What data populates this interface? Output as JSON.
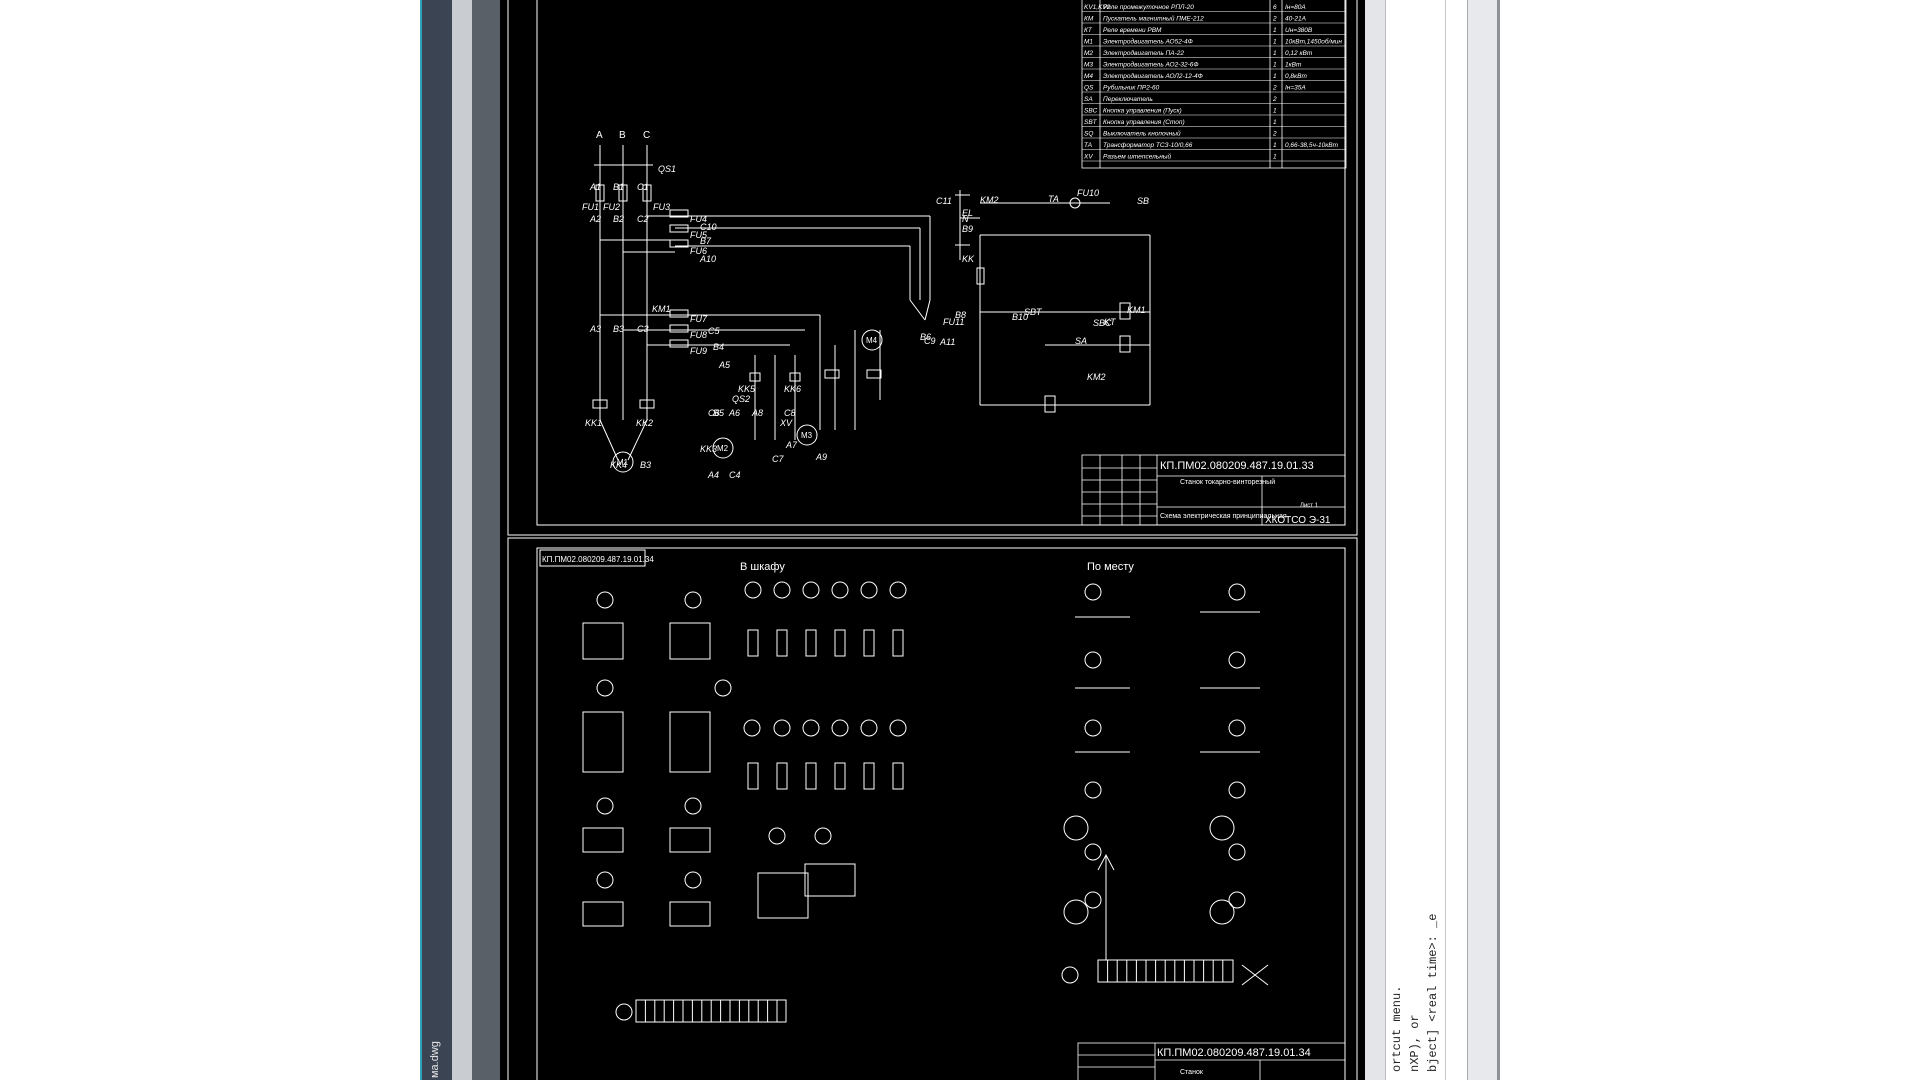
{
  "window": {
    "file_tab": "ма.dwg"
  },
  "command_line": {
    "lines": [
      "ortcut menu.",
      "nXP), or",
      "bject] <real time>: _e"
    ]
  },
  "drawing": {
    "sheet1_code": "КП.ПМ02.080209.487.19.01.33",
    "sheet1_title": "Станок токарно-винторезный",
    "sheet1_subtitle": "Схема электрическая принципиальная",
    "sheet1_org": "ХКОТСО Э-31",
    "sheet1_mark": "Лист 1",
    "sheet2_code": "КП.ПМ02.080209.487.19.01.34",
    "sheet2_title": "Станок",
    "sheet2_label": "КП.ПМ02.080209.487.19.01.34",
    "label_cabinet": "В шкафу",
    "label_local": "По месту",
    "bom_rows": [
      [
        "KV1,KV2",
        "Реле промежуточное РПЛ-20",
        "6",
        "Iн=80А"
      ],
      [
        "КМ",
        "Пускатель магнитный ПМЕ-212",
        "2",
        "40-21А"
      ],
      [
        "КТ",
        "Реле времени РВМ",
        "1",
        "Uн=380В"
      ],
      [
        "М1",
        "Электродвигатель АО52-4Ф",
        "1",
        "10кВт,1450об/мин"
      ],
      [
        "М2",
        "Электродвигатель ПА-22",
        "1",
        "0,12 кВт"
      ],
      [
        "М3",
        "Электродвигатель АО2-32-6Ф",
        "1",
        "1кВт"
      ],
      [
        "М4",
        "Электродвигатель АОЛ2-12-4Ф",
        "1",
        "0,8кВт"
      ],
      [
        "QS",
        "Рубильник ПР2-60",
        "2",
        "Iн=35А"
      ],
      [
        "SA",
        "Переключатель",
        "2",
        ""
      ],
      [
        "SBC",
        "Кнопка управления (Пуск)",
        "1",
        ""
      ],
      [
        "SBT",
        "Кнопка управления (Стоп)",
        "1",
        ""
      ],
      [
        "SQ",
        "Выключатель кнопочный",
        "2",
        ""
      ],
      [
        "ТА",
        "Трансформатор ТСЗ-10/0,66",
        "1",
        "0,66-38,5ч-10кВт"
      ],
      [
        "XV",
        "Разъем штепсельный",
        "1",
        ""
      ]
    ],
    "phase_labels": [
      "A",
      "B",
      "C"
    ],
    "wire_labels": [
      "QS1",
      "A1",
      "B1",
      "C1",
      "FU1",
      "FU2",
      "FU3",
      "A2",
      "B2",
      "C2",
      "FU4",
      "FU5",
      "FU6",
      "C10",
      "B7",
      "A10",
      "KM1",
      "A3",
      "B3",
      "C3",
      "FU7",
      "FU8",
      "FU9",
      "C5",
      "B4",
      "A5",
      "QS2",
      "KK5",
      "KK6",
      "C6",
      "B5",
      "A6",
      "A8",
      "C8",
      "XV",
      "KK1",
      "KK2",
      "KK3",
      "KK4",
      "B3",
      "A4",
      "C4",
      "C7",
      "A7",
      "A9",
      "B6",
      "C9",
      "A11",
      "B8",
      "C11",
      "KM2",
      "TA",
      "FU10",
      "SB",
      "EL",
      "N",
      "B9",
      "KK",
      "FU11",
      "B10",
      "SBT",
      "SBC",
      "KT",
      "KM1",
      "SA",
      "KM2"
    ],
    "motor_labels": [
      "M1",
      "M2",
      "M3",
      "M4"
    ]
  }
}
